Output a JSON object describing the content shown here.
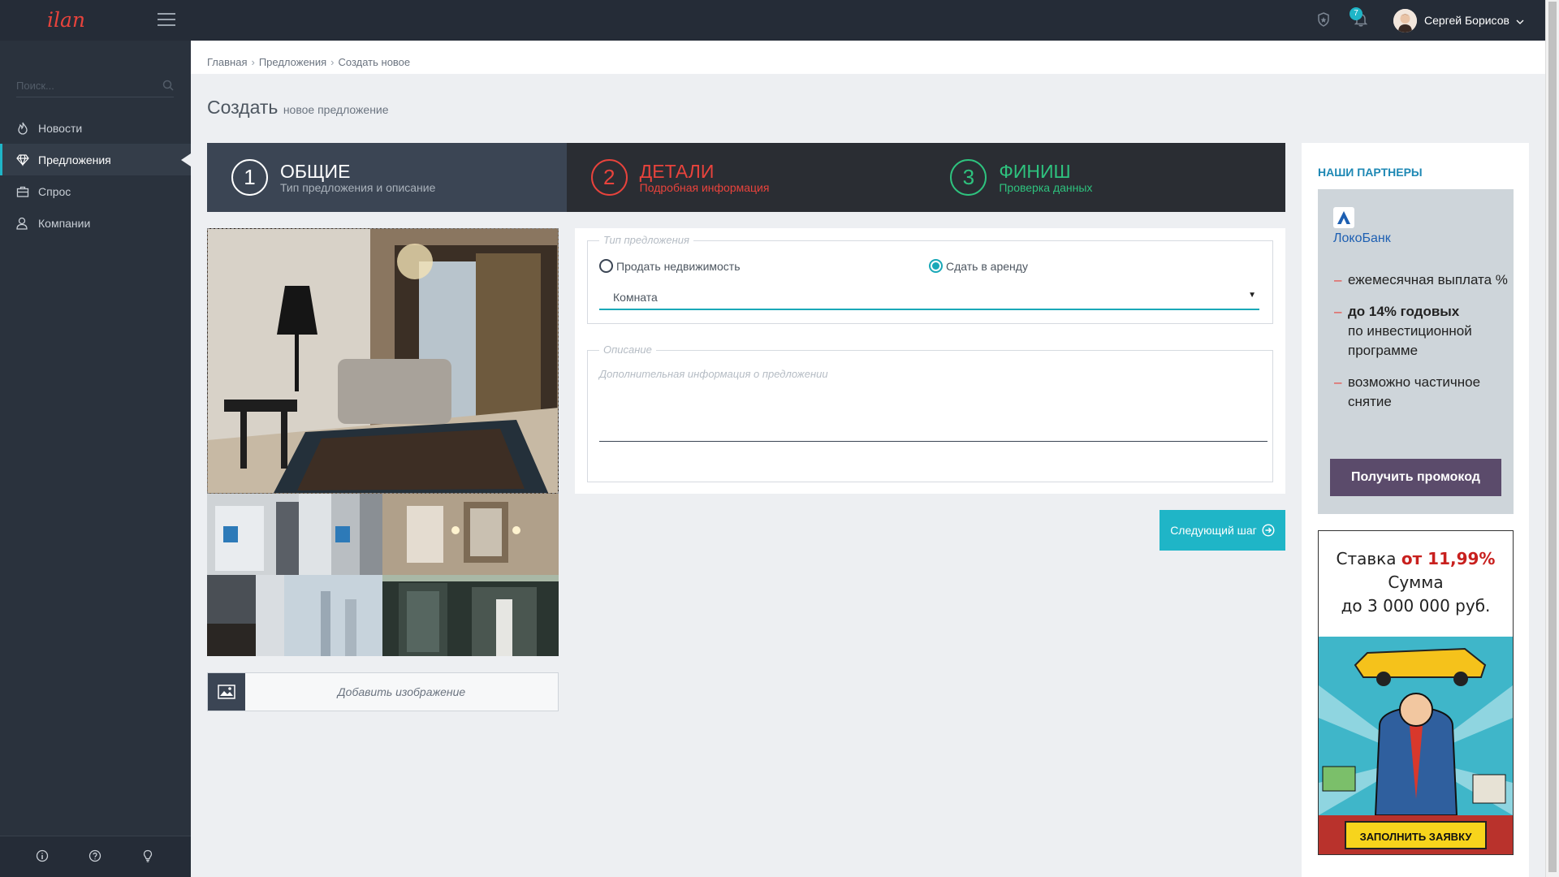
{
  "app": {
    "logo": "ilan"
  },
  "topbar": {
    "notifications_count": "7",
    "user_name": "Сергей Борисов"
  },
  "sidebar": {
    "search_placeholder": "Поиск...",
    "items": [
      {
        "label": "Новости",
        "icon": "fire-icon"
      },
      {
        "label": "Предложения",
        "icon": "diamond-icon",
        "active": true
      },
      {
        "label": "Спрос",
        "icon": "briefcase-icon"
      },
      {
        "label": "Компании",
        "icon": "users-icon"
      }
    ],
    "footer_icons": [
      "info-icon",
      "help-icon",
      "lightbulb-icon"
    ]
  },
  "breadcrumb": [
    "Главная",
    "Предложения",
    "Создать новое"
  ],
  "page": {
    "title": "Создать",
    "subtitle": "новое предложение"
  },
  "steps": [
    {
      "number": "1",
      "title": "ОБЩИЕ",
      "subtitle": "Тип предложения и описание",
      "color": "#ffffff"
    },
    {
      "number": "2",
      "title": "ДЕТАЛИ",
      "subtitle": "Подробная информация",
      "color": "#e8433c"
    },
    {
      "number": "3",
      "title": "ФИНИШ",
      "subtitle": "Проверка данных",
      "color": "#2ec27e"
    }
  ],
  "gallery": {
    "add_label": "Добавить изображение"
  },
  "form": {
    "type_legend": "Тип предложения",
    "radio_sell": "Продать недвижимость",
    "radio_rent": "Сдать в аренду",
    "selected_radio": "rent",
    "property_type": "Комната",
    "description_legend": "Описание",
    "description_placeholder": "Дополнительная информация о предложении"
  },
  "next_button": "Следующий шаг",
  "partners": {
    "title": "НАШИ ПАРТНЕРЫ",
    "bank_name": "ЛокоБанк",
    "bullets": [
      {
        "text": "ежемесячная выплата %",
        "bold": ""
      },
      {
        "bold": "до 14% годовых",
        "text": "по инвестиционной программе"
      },
      {
        "text": "возможно частичное снятие",
        "bold": ""
      }
    ],
    "promo_button": "Получить промокод",
    "banner2": {
      "line1_prefix": "Ставка",
      "line1_rate": "от 11,99%",
      "line2": "Сумма",
      "line3": "до 3 000 000 руб.",
      "cta": "ЗАПОЛНИТЬ ЗАЯВКУ"
    }
  },
  "colors": {
    "accent": "#1fb5c7",
    "sidebar": "#2a323d",
    "topbar": "#252c37",
    "danger": "#e8433c",
    "success": "#2ec27e"
  }
}
